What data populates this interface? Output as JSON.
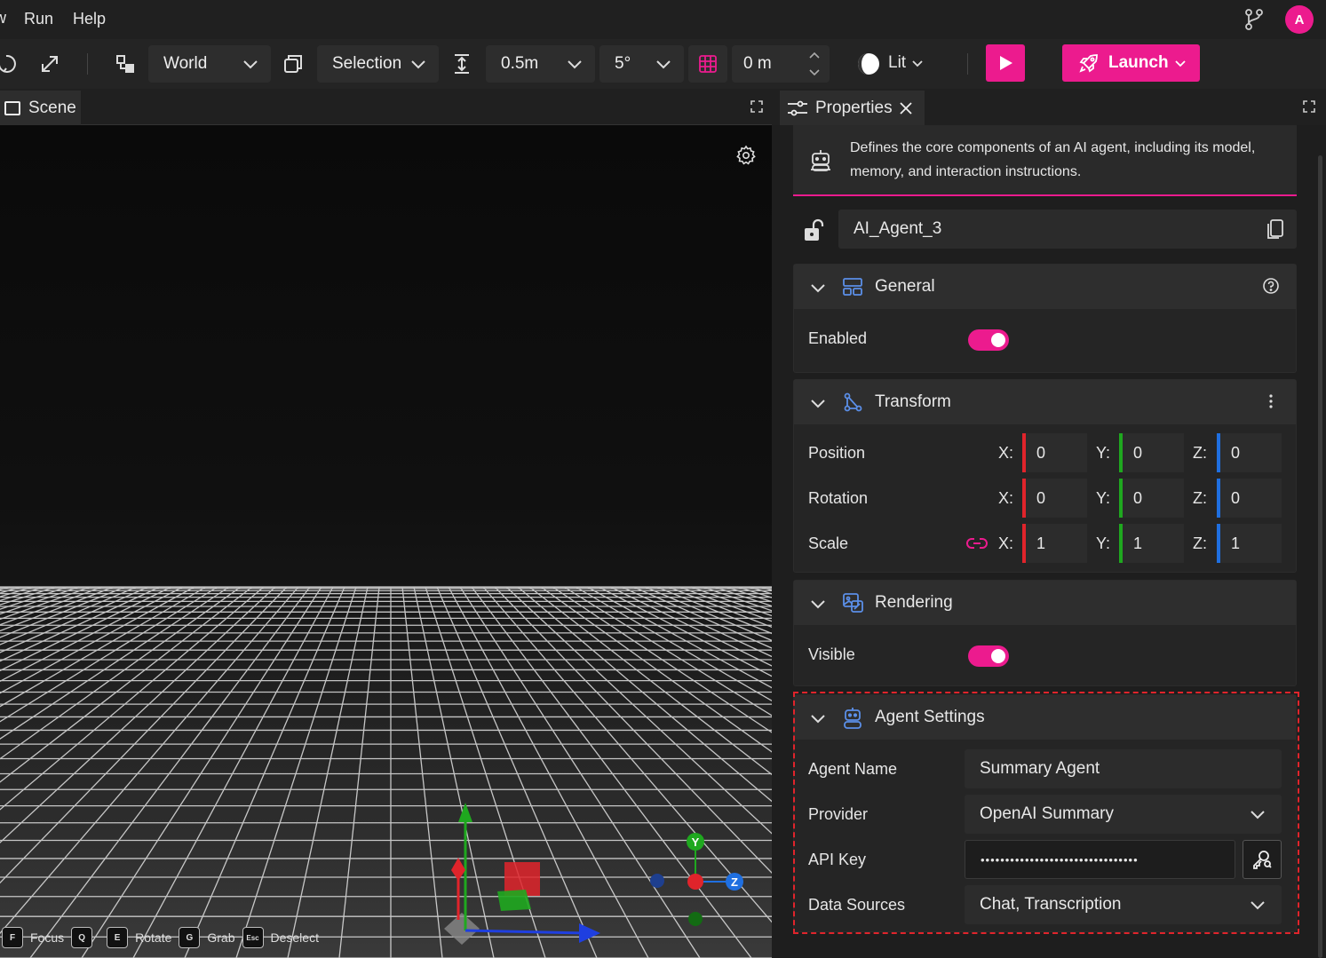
{
  "menu": {
    "cut_item": "w",
    "items": [
      "Run",
      "Help"
    ],
    "avatar_initial": "A"
  },
  "toolbar": {
    "space": "World",
    "select_mode": "Selection",
    "snap_distance": "0.5m",
    "snap_angle": "5°",
    "grid_height": "0 m",
    "lighting": "Lit",
    "launch_label": "Launch"
  },
  "scene": {
    "tab_label": "Scene",
    "gizmo_labels": {
      "y": "Y",
      "z": "Z"
    },
    "shortcuts": [
      {
        "key": "F",
        "label": "Focus"
      },
      {
        "key": "Q",
        "label": ""
      },
      {
        "key": "E",
        "label": "Rotate"
      },
      {
        "key": "G",
        "label": "Grab"
      },
      {
        "key": "Esc",
        "label": "Deselect"
      }
    ]
  },
  "properties": {
    "tab_label": "Properties",
    "description": "Defines the core components of an AI agent, including its model, memory, and interaction instructions.",
    "object_name": "AI_Agent_3",
    "general": {
      "title": "General",
      "enabled_label": "Enabled",
      "enabled": true
    },
    "transform": {
      "title": "Transform",
      "axis_x": "X:",
      "axis_y": "Y:",
      "axis_z": "Z:",
      "position": {
        "label": "Position",
        "x": "0",
        "y": "0",
        "z": "0"
      },
      "rotation": {
        "label": "Rotation",
        "x": "0",
        "y": "0",
        "z": "0"
      },
      "scale": {
        "label": "Scale",
        "x": "1",
        "y": "1",
        "z": "1"
      }
    },
    "rendering": {
      "title": "Rendering",
      "visible_label": "Visible",
      "visible": true
    },
    "agent_settings": {
      "title": "Agent Settings",
      "agent_name_label": "Agent Name",
      "agent_name": "Summary Agent",
      "provider_label": "Provider",
      "provider": "OpenAI Summary",
      "api_key_label": "API Key",
      "api_key_masked": "••••••••••••••••••••••••••••••••",
      "data_sources_label": "Data Sources",
      "data_sources": "Chat, Transcription"
    }
  },
  "colors": {
    "accent": "#ec1b8e",
    "axis_x": "#e0242b",
    "axis_y": "#1fa81f",
    "axis_z": "#1f6fe0"
  }
}
